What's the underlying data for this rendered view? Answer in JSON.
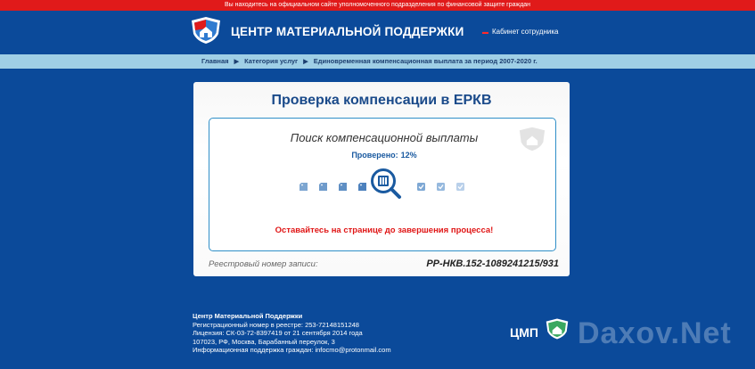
{
  "topbar": {
    "notice": "Вы находитесь на официальном сайте уполномоченного подразделения по финансовой защите граждан"
  },
  "header": {
    "site_title": "ЦЕНТР МАТЕРИАЛЬНОЙ ПОДДЕРЖКИ",
    "cabinet_link": "Кабинет сотрудника"
  },
  "breadcrumb": [
    "Главная",
    "Категория услуг",
    "Единовременная компенсационная выплата за период 2007-2020 г."
  ],
  "card": {
    "title": "Проверка компенсации в ЕРКВ",
    "search_title": "Поиск компенсационной выплаты",
    "progress_label": "Проверено:",
    "progress_value": "12%",
    "progress_fraction": 0.12,
    "warning": "Оставайтесь на странице до завершения процесса!",
    "registry_label": "Реестровый номер записи:",
    "registry_number": "РР-НКВ.152-1089241215/931"
  },
  "footer": {
    "org_name": "Центр Материальной Поддержки",
    "registration": "Регистрационный номер в реестре: 253-72148151248",
    "license": "Лицензия: СК-03-72-8397419 от 21 сентября 2014 года",
    "address": "107023, РФ, Москва, Барабанный переулок, 3",
    "support": "Информационная поддержка граждан: infocmo@protonmail.com"
  },
  "brand": {
    "short": "ЦМП",
    "watermark": "Daxov.Net"
  },
  "colors": {
    "background": "#0b4a9a",
    "topbar": "#e01a1a",
    "breadcrumb_bar": "#9fcfe6",
    "accent": "#1a5aa0",
    "warning": "#e01515"
  },
  "icons": {
    "logo": "shield-house-icon",
    "step_pending": "tag-icon",
    "step_done": "check-tag-icon",
    "scan": "magnifier-icon"
  }
}
